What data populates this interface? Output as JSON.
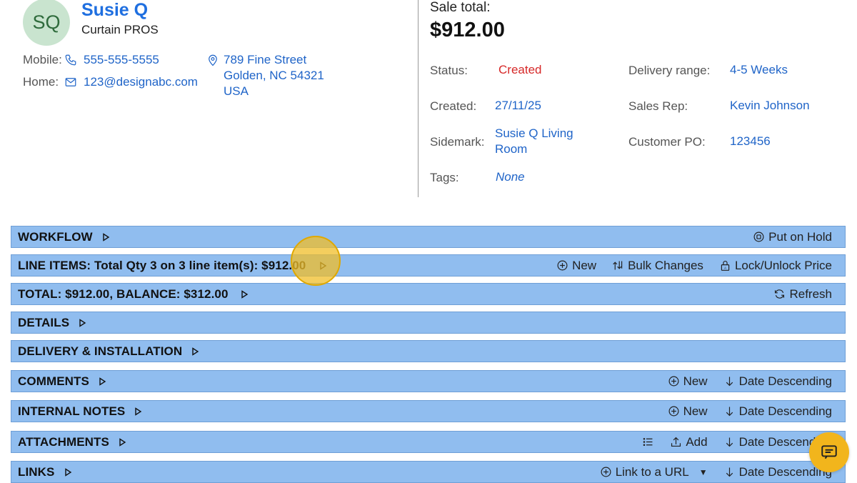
{
  "customer": {
    "initials": "SQ",
    "name": "Susie Q",
    "company": "Curtain PROS",
    "mobile_label": "Mobile:",
    "mobile": "555-555-5555",
    "home_label": "Home:",
    "email": "123@designabc.com",
    "address_line1": "789 Fine Street",
    "address_line2": "Golden, NC 54321",
    "address_line3": "USA"
  },
  "sale": {
    "total_label": "Sale total:",
    "total": "$912.00",
    "status_label": "Status:",
    "status": "Created",
    "status_color": "#d62828",
    "delivery_label": "Delivery range:",
    "delivery": "4-5 Weeks",
    "created_label": "Created:",
    "created": "27/11/25",
    "rep_label": "Sales Rep:",
    "rep": "Kevin Johnson",
    "sidemark_label": "Sidemark:",
    "sidemark_line1": "Susie Q Living",
    "sidemark_line2": "Room",
    "po_label": "Customer PO:",
    "po": "123456",
    "tags_label": "Tags:",
    "tags": "None"
  },
  "sections": {
    "workflow": {
      "title": "WORKFLOW",
      "hold": "Put on Hold"
    },
    "line_items": {
      "title": "LINE ITEMS: Total Qty 3 on 3 line item(s): $912.00",
      "new": "New",
      "bulk": "Bulk Changes",
      "lock": "Lock/Unlock Price"
    },
    "total": {
      "title": "TOTAL: $912.00, BALANCE: $312.00",
      "refresh": "Refresh"
    },
    "details": {
      "title": "DETAILS"
    },
    "delivery": {
      "title": "DELIVERY & INSTALLATION"
    },
    "comments": {
      "title": "COMMENTS",
      "new": "New",
      "sort": "Date Descending"
    },
    "internal_notes": {
      "title": "INTERNAL NOTES",
      "new": "New",
      "sort": "Date Descending"
    },
    "attachments": {
      "title": "ATTACHMENTS",
      "add": "Add",
      "sort": "Date Descending"
    },
    "links": {
      "title": "LINKS",
      "link_url": "Link to a URL",
      "sort": "Date Descending"
    }
  },
  "colors": {
    "bar_bg": "#90bdef",
    "link": "#1f64c8",
    "name": "#1f6fe0",
    "fab": "#f2b51c"
  }
}
